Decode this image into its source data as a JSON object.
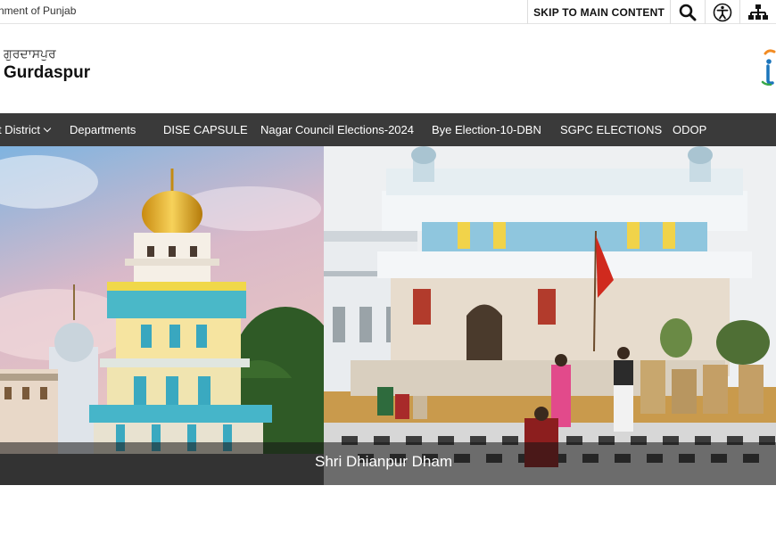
{
  "topbar": {
    "government_text": "nment of Punjab",
    "skip_link": "SKIP TO MAIN CONTENT",
    "tools": [
      {
        "icon": "search-icon"
      },
      {
        "icon": "accessibility-icon"
      },
      {
        "icon": "sitemap-icon"
      }
    ]
  },
  "header": {
    "punjabi_title": "ਗੁਰਦਾਸਪੁਰ",
    "district_title": "Gurdaspur"
  },
  "nav": {
    "items": [
      {
        "label": "t District",
        "has_dropdown": true
      },
      {
        "label": "Departments"
      },
      {
        "label": "DISE CAPSULE"
      },
      {
        "label": "Nagar Council Elections-2024"
      },
      {
        "label": "Bye Election-10-DBN"
      },
      {
        "label": "SGPC ELECTIONS"
      },
      {
        "label": "ODOP"
      }
    ]
  },
  "banner": {
    "caption": "Shri Dhianpur Dham"
  },
  "colors": {
    "nav_background": "#3a3a3a",
    "topbar_background": "#ffffff",
    "caption_overlay": "#141414"
  }
}
